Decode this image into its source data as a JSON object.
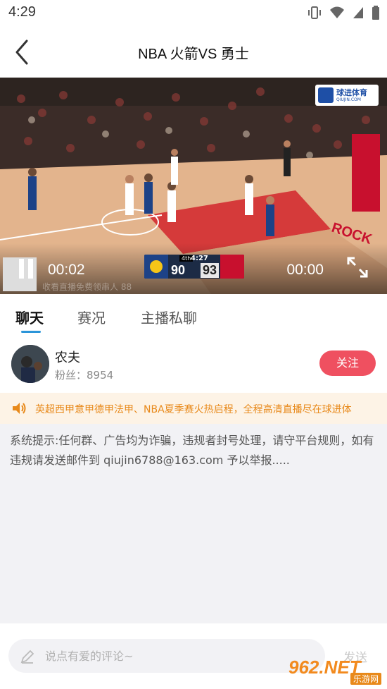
{
  "status_bar": {
    "time": "4:29",
    "icons": [
      "vibrate-icon",
      "wifi-icon",
      "signal-icon",
      "battery-icon"
    ]
  },
  "nav": {
    "title": "NBA 火箭VS 勇士",
    "back_icon": "chevron-left-icon"
  },
  "video": {
    "brand_logo_text": "球进体育",
    "brand_logo_sub": "QIUJIN.COM",
    "current_time": "00:02",
    "duration": "00:00",
    "watermark_text": "收看直播免费领串人   88",
    "scorebug": {
      "period": "4th",
      "clock": "4:27",
      "home_score": "90",
      "away_score": "93"
    }
  },
  "tabs": [
    {
      "label": "聊天",
      "active": true
    },
    {
      "label": "赛况",
      "active": false
    },
    {
      "label": "主播私聊",
      "active": false
    }
  ],
  "streamer": {
    "name": "农夫",
    "fans": "粉丝：8954",
    "follow_label": "关注"
  },
  "notice": {
    "text": "英超西甲意甲德甲法甲、NBA夏季赛火热启程，全程高清直播尽在球进体"
  },
  "chat": {
    "system_message": "系统提示:任何群、广告均为诈骗，违规者封号处理，请守平台规则，如有违规请发送邮件到 qiujin6788@163.com 予以举报....."
  },
  "composer": {
    "placeholder": "说点有爱的评论~",
    "value": "",
    "send_label": "发送"
  },
  "site_watermark": {
    "main": "962.NET",
    "sub": "乐游网"
  },
  "colors": {
    "accent_blue": "#2b95d9",
    "follow_red": "#ef5060",
    "notice_orange": "#e8891a",
    "notice_bg": "#fdf3e6"
  }
}
